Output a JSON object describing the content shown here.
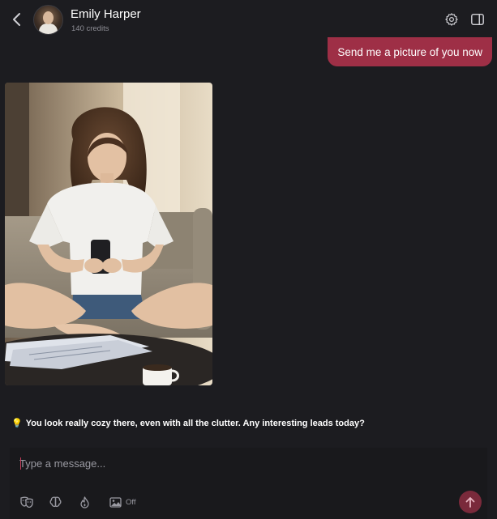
{
  "header": {
    "contact_name": "Emily Harper",
    "credits": "140 credits",
    "icons": [
      "chevron-left-icon",
      "avatar",
      "gear-icon",
      "sidebar-panel-icon"
    ]
  },
  "messages": [
    {
      "role": "user",
      "text": "Send me a picture of you now"
    },
    {
      "role": "assistant",
      "type": "image",
      "image": "photo-woman-on-couch-with-phone"
    },
    {
      "role": "assistant",
      "emoji": "💡",
      "text": "You look really cozy there, even with all the clutter. Any interesting leads today?"
    }
  ],
  "composer": {
    "placeholder": "Type a message...",
    "tools": [
      {
        "icon": "theater-masks-icon"
      },
      {
        "icon": "brain-icon"
      },
      {
        "icon": "flame-icon"
      },
      {
        "icon": "image-icon",
        "label": "Off"
      }
    ],
    "send_icon": "arrow-up-icon"
  },
  "colors": {
    "background": "#1c1c20",
    "accent": "#9e2f46",
    "send_button": "#7a2a3b"
  }
}
